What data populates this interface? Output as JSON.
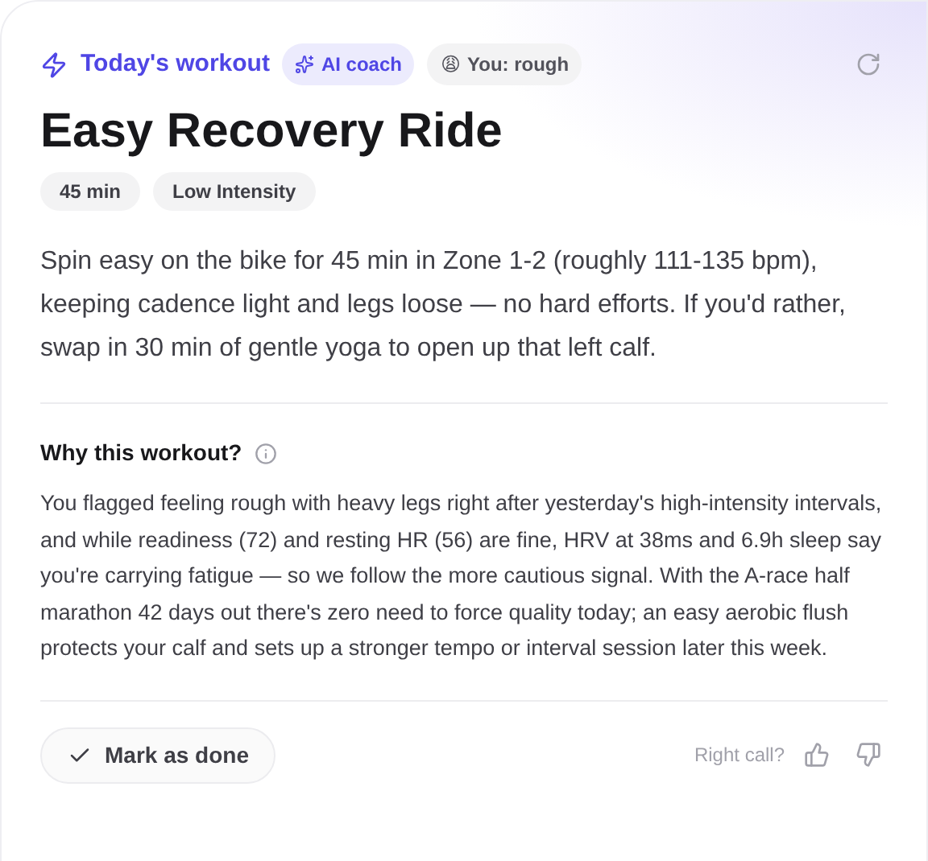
{
  "header": {
    "label": "Today's workout",
    "badges": [
      {
        "kind": "coach",
        "text": "AI coach"
      },
      {
        "kind": "mood",
        "emoji": "😩",
        "text": "You: rough"
      }
    ]
  },
  "title": "Easy Recovery Ride",
  "tags": [
    "45 min",
    "Low Intensity"
  ],
  "description": "Spin easy on the bike for 45 min in Zone 1-2 (roughly 111-135 bpm), keeping cadence light and legs loose — no hard efforts. If you'd rather, swap in 30 min of gentle yoga to open up that left calf.",
  "why": {
    "heading": "Why this workout?",
    "text": "You flagged feeling rough with heavy legs right after yesterday's high-intensity intervals, and while readiness (72) and resting HR (56) are fine, HRV at 38ms and 6.9h sleep say you're carrying fatigue — so we follow the more cautious signal. With the A-race half marathon 42 days out there's zero need to force quality today; an easy aerobic flush protects your calf and sets up a stronger tempo or interval session later this week."
  },
  "footer": {
    "button": "Mark as done",
    "feedback_label": "Right call?"
  }
}
